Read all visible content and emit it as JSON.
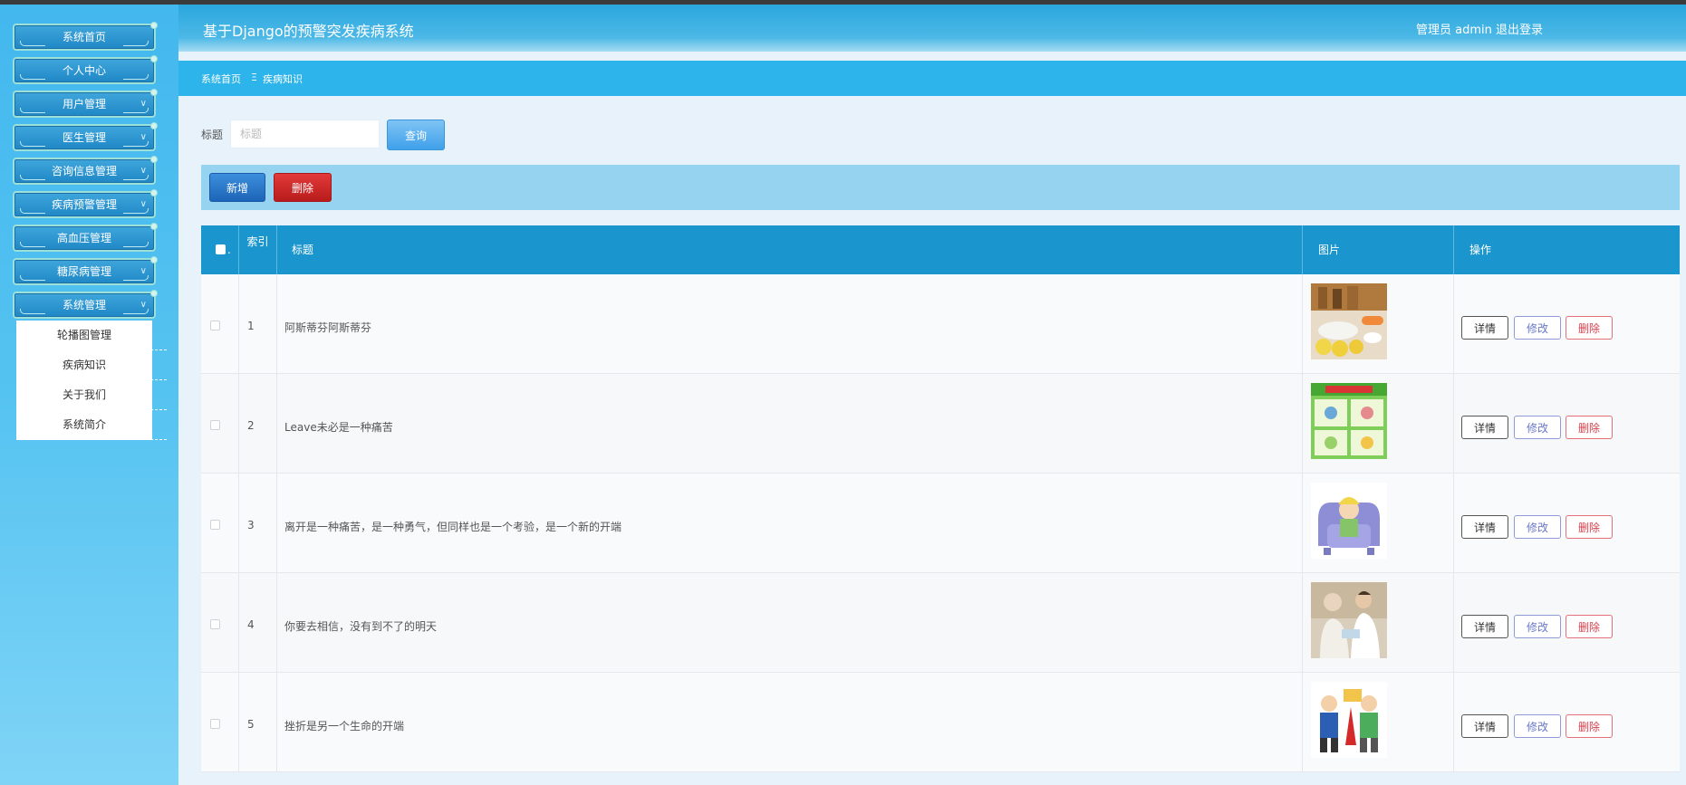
{
  "header": {
    "title": "基于Django的预警突发疾病系统",
    "user": "管理员 admin",
    "logout": "退出登录"
  },
  "breadcrumb": {
    "home": "系统首页",
    "separator": "Ξ",
    "current": "疾病知识"
  },
  "sidebar": {
    "items": [
      {
        "label": "系统首页"
      },
      {
        "label": "个人中心"
      },
      {
        "label": "用户管理"
      },
      {
        "label": "医生管理"
      },
      {
        "label": "咨询信息管理"
      },
      {
        "label": "疾病预警管理"
      },
      {
        "label": "高血压管理"
      },
      {
        "label": "糖尿病管理"
      },
      {
        "label": "系统管理"
      }
    ],
    "submenu": [
      {
        "label": "轮播图管理"
      },
      {
        "label": "疾病知识"
      },
      {
        "label": "关于我们"
      },
      {
        "label": "系统简介"
      }
    ]
  },
  "search": {
    "label": "标题",
    "placeholder": "标题",
    "value": "",
    "button": "查询"
  },
  "toolbar": {
    "add": "新增",
    "delete": "删除"
  },
  "table": {
    "columns": {
      "index": "索引",
      "title": "标题",
      "image": "图片",
      "actions": "操作"
    },
    "rows": [
      {
        "index": "1",
        "title": "阿斯蒂芬阿斯蒂芬"
      },
      {
        "index": "2",
        "title": "Leave未必是一种痛苦"
      },
      {
        "index": "3",
        "title": "离开是一种痛苦，是一种勇气，但同样也是一个考验，是一个新的开端"
      },
      {
        "index": "4",
        "title": "你要去相信，没有到不了的明天"
      },
      {
        "index": "5",
        "title": "挫折是另一个生命的开端"
      }
    ],
    "actions": {
      "detail": "详情",
      "edit": "修改",
      "delete": "删除"
    }
  },
  "colors": {
    "header": "#2aa7de",
    "table_header": "#1b95cd",
    "toolbar": "#95d3f0",
    "danger": "#d02424"
  }
}
